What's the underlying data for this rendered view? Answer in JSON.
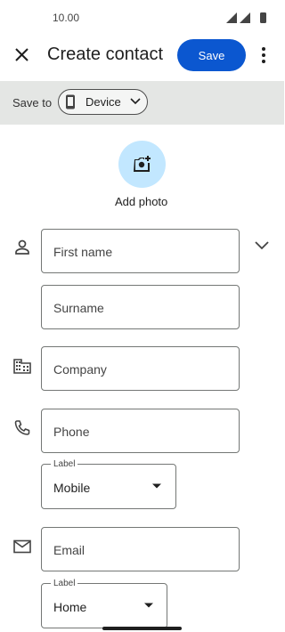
{
  "status": {
    "time": "10.00"
  },
  "header": {
    "title": "Create contact",
    "save_label": "Save"
  },
  "save_to": {
    "label": "Save to",
    "device": "Device"
  },
  "photo": {
    "label": "Add photo"
  },
  "fields": {
    "first_name": "First name",
    "surname": "Surname",
    "company": "Company",
    "phone": "Phone",
    "phone_label_caption": "Label",
    "phone_label_value": "Mobile",
    "email": "Email",
    "email_label_caption": "Label",
    "email_label_value": "Home"
  },
  "colors": {
    "accent": "#0b57d0",
    "photo_bg": "#c2e7ff",
    "save_bar_bg": "#e4e6e4"
  }
}
